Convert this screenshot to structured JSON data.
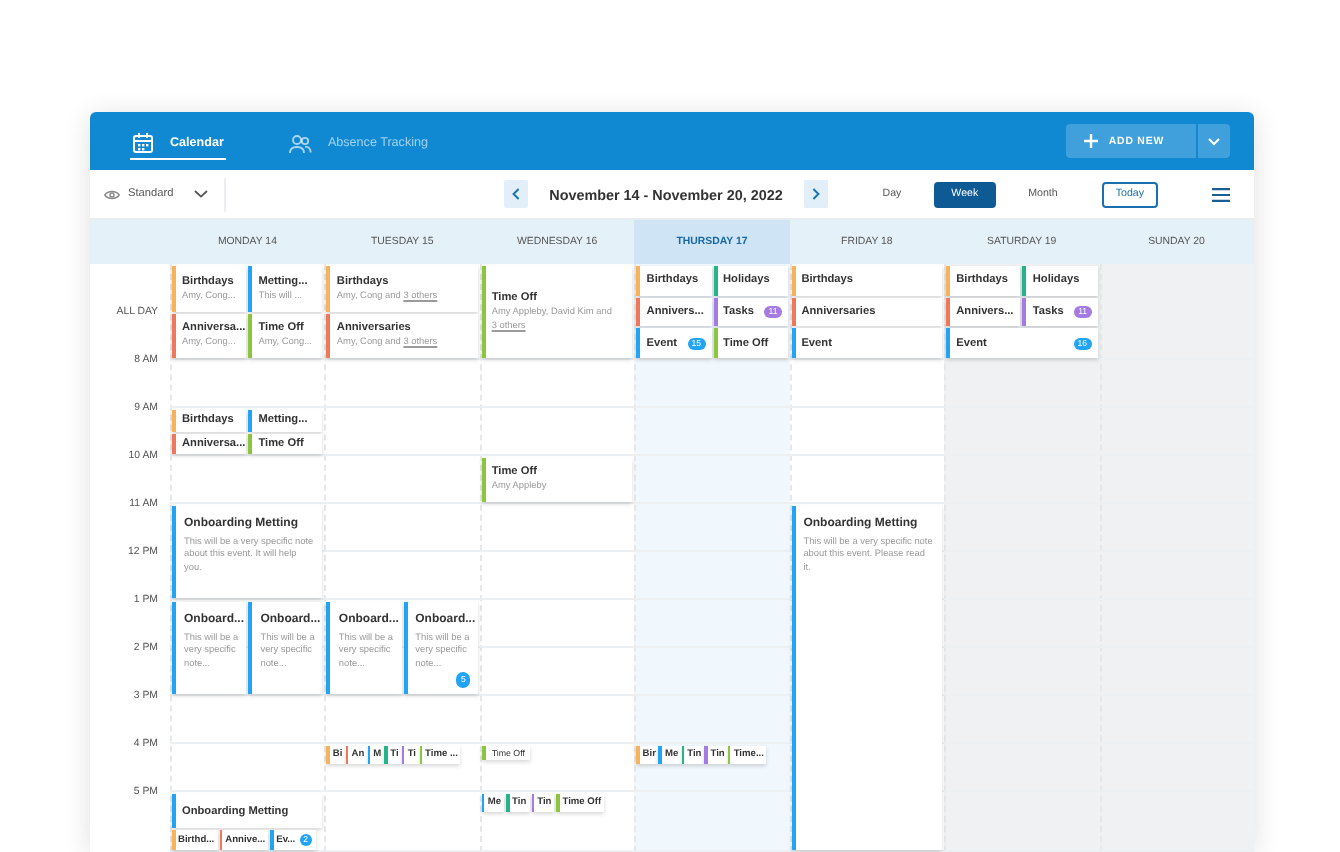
{
  "tabs": [
    {
      "label": "Calendar",
      "selected": true
    },
    {
      "label": "Absence Tracking",
      "selected": false
    }
  ],
  "add_new": {
    "label": "ADD NEW"
  },
  "view_filter": {
    "label": "Standard"
  },
  "date_range": "November 14 - November 20, 2022",
  "views": [
    {
      "label": "Day",
      "selected": false
    },
    {
      "label": "Week",
      "selected": true
    },
    {
      "label": "Month",
      "selected": false
    }
  ],
  "today_button": "Today",
  "days": [
    {
      "label": "MONDAY 14",
      "today": false,
      "weekend": false
    },
    {
      "label": "TUESDAY 15",
      "today": false,
      "weekend": false
    },
    {
      "label": "WEDNESDAY 16",
      "today": false,
      "weekend": false
    },
    {
      "label": "THURSDAY 17",
      "today": true,
      "weekend": false
    },
    {
      "label": "FRIDAY 18",
      "today": false,
      "weekend": false
    },
    {
      "label": "SATURDAY 19",
      "today": false,
      "weekend": true
    },
    {
      "label": "SUNDAY 20",
      "today": false,
      "weekend": true
    }
  ],
  "rows": [
    {
      "label": "ALL DAY",
      "cells": [
        {
          "kind": "hour",
          "lines": [
            [
              {
                "kind": "stack",
                "title": "Birthdays",
                "color": "#f7b35b",
                "note": "Amy, Cong..."
              },
              {
                "kind": "stack",
                "title": "Metting...",
                "color": "#21a4f3",
                "note": "This will ..."
              }
            ],
            [
              {
                "kind": "stack",
                "title": "Anniversa...",
                "color": "#f0775a",
                "note": "Amy, Cong..."
              },
              {
                "kind": "stack",
                "title": "Time Off",
                "color": "#8cc63f",
                "note": "Amy, Cong..."
              }
            ]
          ]
        },
        {
          "kind": "hour",
          "lines": [
            [
              {
                "kind": "stack",
                "title": "Birthdays",
                "color": "#f7b35b",
                "note": "Amy, Cong and",
                "link": "3 others"
              }
            ],
            [
              {
                "kind": "stack",
                "title": "Anniversaries",
                "color": "#f0775a",
                "note": "Amy, Cong and",
                "link": "3 others"
              }
            ]
          ]
        },
        {
          "kind": "hour",
          "lines": [
            [
              {
                "kind": "stack",
                "title": "Time Off",
                "color": "#8cc63f",
                "note": "Amy Appleby, David Kim and",
                "link": "3 others"
              }
            ]
          ]
        },
        {
          "kind": "hour",
          "lines": [
            [
              {
                "kind": "chip",
                "title": "Birthdays",
                "color": "#f7b35b"
              },
              {
                "kind": "chip",
                "title": "Holidays",
                "color": "#26b38a"
              }
            ],
            [
              {
                "kind": "chip",
                "title": "Annivers...",
                "color": "#f0775a"
              },
              {
                "kind": "chip",
                "title": "Tasks",
                "color": "#a47be3",
                "badge": "11"
              }
            ],
            [
              {
                "kind": "chip",
                "title": "Event",
                "color": "#21a4f3",
                "badge": "15"
              },
              {
                "kind": "chip",
                "title": "Time Off",
                "color": "#8cc63f"
              }
            ]
          ]
        },
        {
          "kind": "hour",
          "lines": [
            [
              {
                "kind": "chip",
                "title": "Birthdays",
                "color": "#f7b35b"
              }
            ],
            [
              {
                "kind": "chip",
                "title": "Anniversaries",
                "color": "#f0775a"
              }
            ],
            [
              {
                "kind": "chip",
                "title": "Event",
                "color": "#21a4f3"
              }
            ]
          ]
        },
        {
          "kind": "hour",
          "lines": [
            [
              {
                "kind": "chip",
                "title": "Birthdays",
                "color": "#f7b35b"
              },
              {
                "kind": "chip",
                "title": "Holidays",
                "color": "#26b38a"
              }
            ],
            [
              {
                "kind": "chip",
                "title": "Annivers...",
                "color": "#f0775a"
              },
              {
                "kind": "chip",
                "title": "Tasks",
                "color": "#a47be3",
                "badge": "11"
              }
            ],
            [
              {
                "kind": "chip",
                "title": "Event",
                "color": "#21a4f3",
                "badge": "16"
              }
            ]
          ]
        }
      ]
    },
    {
      "label": "8 AM"
    },
    {
      "label": "9 AM",
      "cells": [
        {
          "kind": "hour",
          "lines": [
            [
              {
                "kind": "chip",
                "title": "Birthdays",
                "color": "#f7b35b"
              },
              {
                "kind": "chip",
                "title": "Metting...",
                "color": "#21a4f3"
              }
            ],
            [
              {
                "kind": "chip",
                "title": "Anniversa...",
                "color": "#f0775a"
              },
              {
                "kind": "chip",
                "title": "Time Off",
                "color": "#8cc63f"
              }
            ]
          ]
        }
      ]
    },
    {
      "label": "10 AM",
      "cells": [
        {
          "kind": "empty"
        },
        {
          "kind": "empty"
        },
        {
          "kind": "hour",
          "lines": [
            [
              {
                "kind": "stack",
                "title": "Time Off",
                "color": "#8cc63f",
                "note": "Amy Appleby"
              }
            ]
          ]
        }
      ]
    },
    {
      "label": "11 AM",
      "cells": [
        {
          "kind": "two-hours",
          "lines": [
            [
              {
                "kind": "card",
                "title": "Onboarding Metting",
                "color": "#21a4f3",
                "note": "This will be a very specific note about this event. It will help you."
              }
            ]
          ]
        },
        {
          "kind": "empty"
        },
        {
          "kind": "empty"
        },
        {
          "kind": "empty"
        },
        {
          "kind": "to-end",
          "lines": [
            [
              {
                "kind": "card",
                "title": "Onboarding Metting",
                "color": "#21a4f3",
                "note": "This will be a very specific note about this event. Please read it."
              }
            ]
          ]
        }
      ]
    },
    {
      "label": "12 PM"
    },
    {
      "label": "1 PM",
      "cells": [
        {
          "kind": "two-hours",
          "lines": [
            [
              {
                "kind": "card",
                "title": "Onboard...",
                "color": "#21a4f3",
                "note": "This will be a very specific note..."
              },
              {
                "kind": "card",
                "title": "Onboard...",
                "color": "#21a4f3",
                "note": "This will be a very specific note..."
              }
            ]
          ]
        },
        {
          "kind": "two-hours",
          "lines": [
            [
              {
                "kind": "card",
                "title": "Onboard...",
                "color": "#21a4f3",
                "note": "This will be a very specific note..."
              },
              {
                "kind": "card",
                "title": "Onboard...",
                "color": "#21a4f3",
                "note": "This will be a very specific note...",
                "badge": "5"
              }
            ]
          ]
        }
      ]
    },
    {
      "label": "2 PM"
    },
    {
      "label": "3 PM"
    },
    {
      "label": "4 PM",
      "cells": [
        {
          "kind": "empty"
        },
        {
          "kind": "hour",
          "lines": [
            [
              {
                "kind": "stub",
                "title": "Bi",
                "color": "#f7b35b"
              },
              {
                "kind": "stub",
                "title": "An",
                "color": "#f0775a"
              },
              {
                "kind": "stub",
                "title": "M",
                "color": "#21a4f3"
              },
              {
                "kind": "stub",
                "title": "Ti",
                "color": "#26b38a"
              },
              {
                "kind": "stub",
                "title": "Ti",
                "color": "#a47be3"
              },
              {
                "kind": "stub",
                "title": "Time ...",
                "color": "#8cc63f"
              }
            ]
          ]
        },
        {
          "kind": "hour",
          "lines": [
            [
              {
                "kind": "mini",
                "title": "Time Off",
                "color": "#8cc63f"
              }
            ]
          ]
        },
        {
          "kind": "hour",
          "lines": [
            [
              {
                "kind": "stub",
                "title": "Bir",
                "color": "#f7b35b"
              },
              {
                "kind": "stub",
                "title": "Me",
                "color": "#21a4f3"
              },
              {
                "kind": "stub",
                "title": "Tin",
                "color": "#26b38a"
              },
              {
                "kind": "stub",
                "title": "Tin",
                "color": "#a47be3"
              },
              {
                "kind": "stub",
                "title": "Time...",
                "color": "#8cc63f"
              }
            ]
          ]
        }
      ]
    },
    {
      "label": "5 PM",
      "cells": [
        {
          "kind": "hour",
          "lines": [
            [
              {
                "kind": "chip",
                "title": "Onboarding Metting",
                "color": "#21a4f3"
              }
            ],
            [
              {
                "kind": "stub",
                "title": "Birthd...",
                "color": "#f7b35b"
              },
              {
                "kind": "stub",
                "title": "Annive...",
                "color": "#f0775a"
              },
              {
                "kind": "stub",
                "title": "Ev...",
                "color": "#21a4f3",
                "badge": "2"
              }
            ]
          ]
        },
        {
          "kind": "empty"
        },
        {
          "kind": "hour",
          "lines": [
            [
              {
                "kind": "stub",
                "title": "Me",
                "color": "#21a4f3"
              },
              {
                "kind": "stub",
                "title": "Tin",
                "color": "#26b38a"
              },
              {
                "kind": "stub",
                "title": "Tin",
                "color": "#a47be3"
              },
              {
                "kind": "stub",
                "title": "Time Off",
                "color": "#8cc63f"
              }
            ]
          ]
        }
      ]
    }
  ]
}
